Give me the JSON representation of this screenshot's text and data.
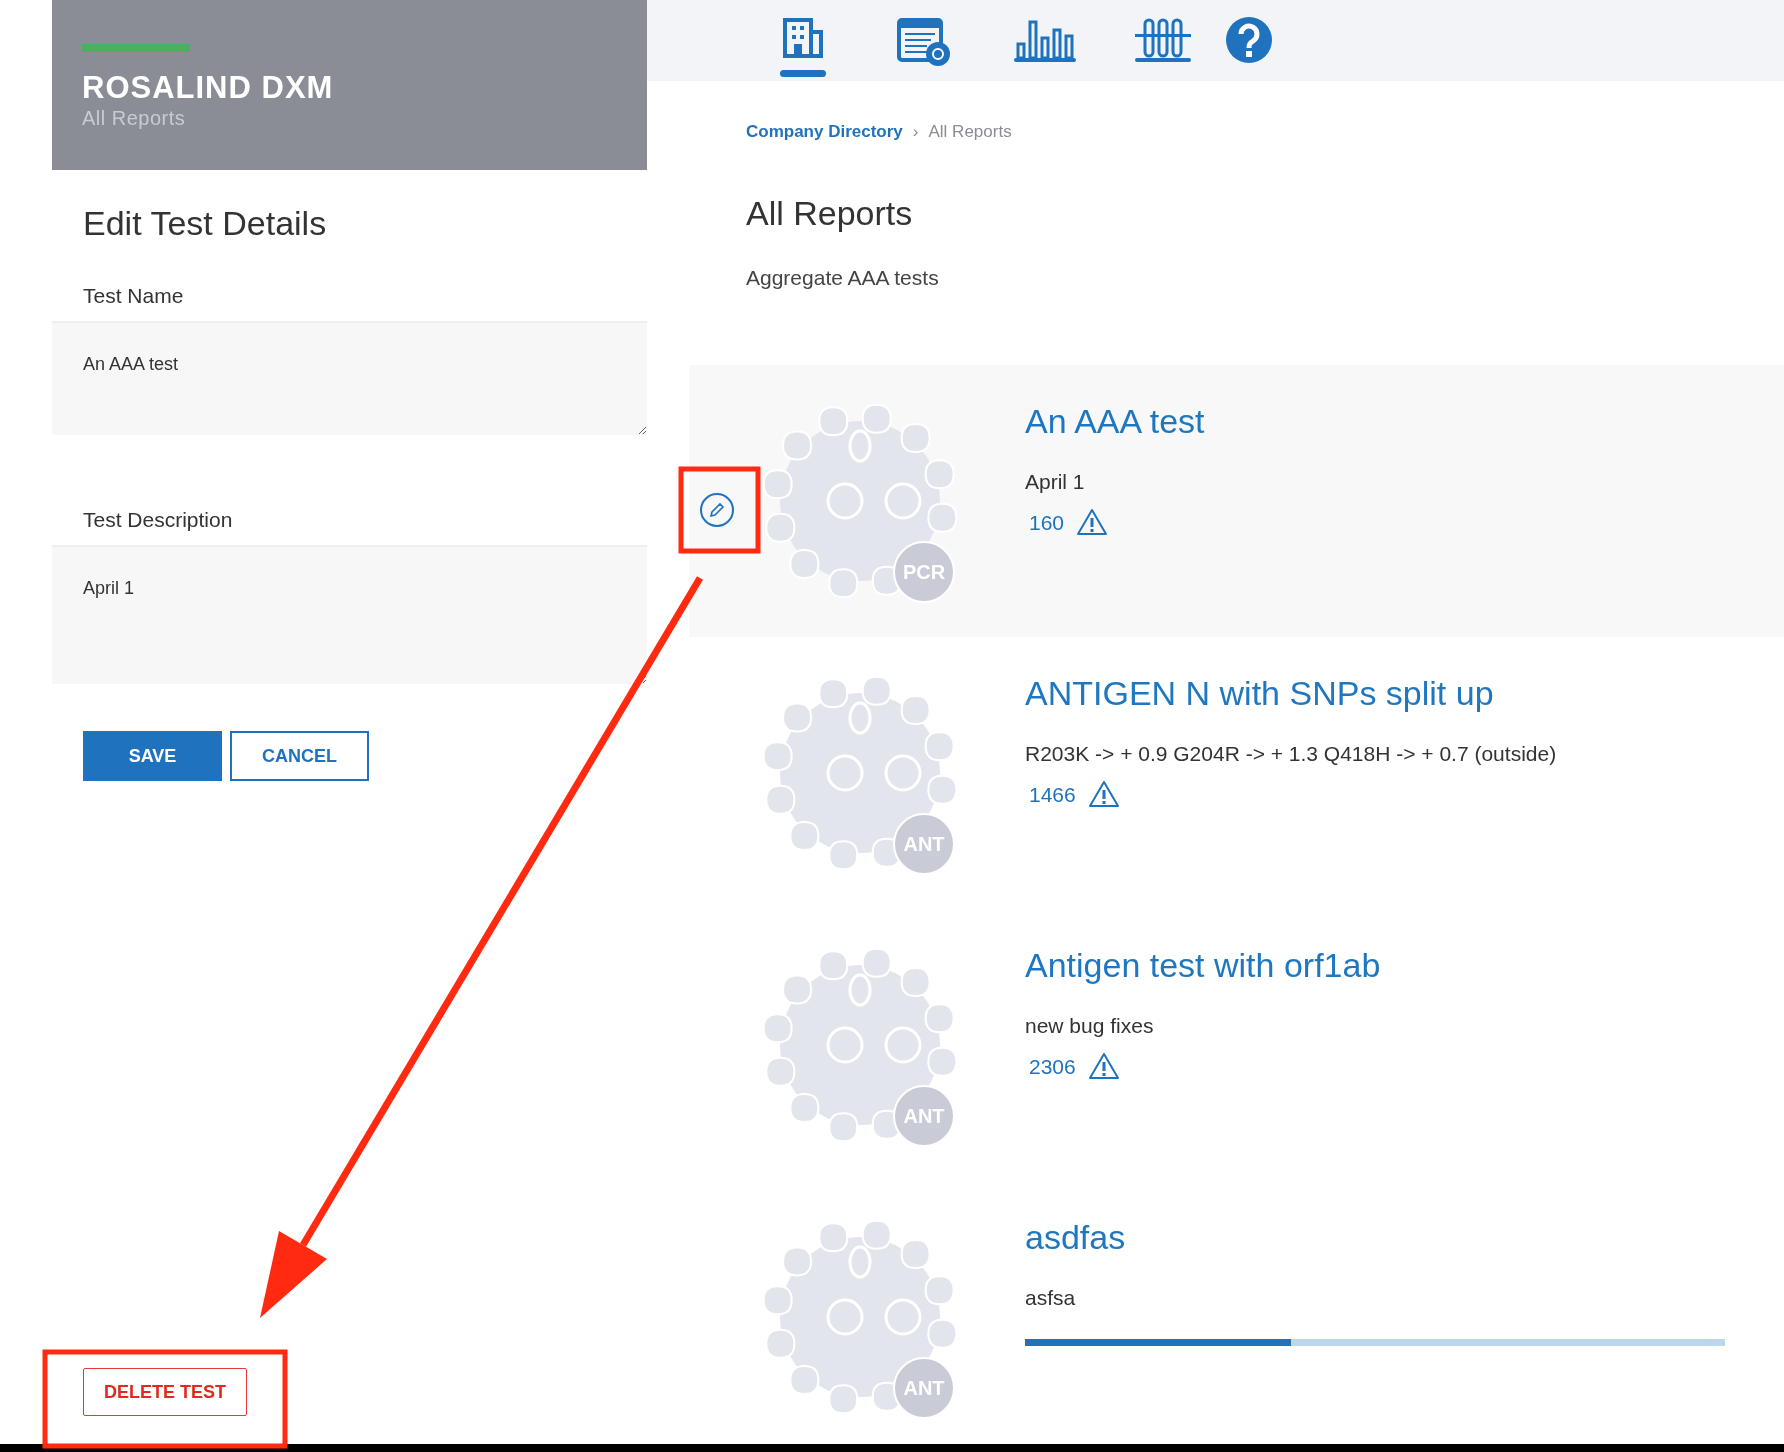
{
  "sidebar_header": {
    "title": "ROSALIND DXM",
    "subtitle": "All Reports"
  },
  "edit_panel": {
    "heading": "Edit Test Details",
    "fields": [
      {
        "label": "Test Name",
        "value": "An AAA test"
      },
      {
        "label": "Test Description",
        "value": "April 1"
      }
    ],
    "buttons": [
      {
        "label": "SAVE",
        "kind": "primary"
      },
      {
        "label": "CANCEL",
        "kind": "secondary"
      }
    ],
    "delete_button": "DELETE TEST"
  },
  "nav": {
    "tabs": [
      {
        "kind": "building",
        "selected": true
      },
      {
        "kind": "table",
        "selected": false
      },
      {
        "kind": "chart",
        "selected": false
      },
      {
        "kind": "tubes",
        "selected": false
      },
      {
        "kind": "help",
        "selected": false
      }
    ]
  },
  "breadcrumb": [
    {
      "label": "Company Directory",
      "current": false
    },
    {
      "label": "›",
      "kind": "separator"
    },
    {
      "label": "All Reports",
      "current": true
    }
  ],
  "page": {
    "title": "All Reports",
    "subtitle": "Aggregate AAA tests"
  },
  "reports": [
    {
      "title": "An AAA test",
      "description": "April 1",
      "badge": "PCR",
      "count": "160",
      "kind": "count",
      "highlighted": true
    },
    {
      "title": "ANTIGEN N with SNPs split up",
      "description": "R203K -> + 0.9 G204R -> + 1.3 Q418H -> + 0.7 (outside)",
      "badge": "ANT",
      "count": "1466",
      "kind": "count",
      "highlighted": false
    },
    {
      "title": "Antigen test with orf1ab",
      "description": "new bug fixes",
      "badge": "ANT",
      "count": "2306",
      "kind": "count",
      "highlighted": false
    },
    {
      "title": "asdfas",
      "description": "asfsa",
      "badge": "ANT",
      "kind": "progress",
      "level": 0.38,
      "highlighted": false
    }
  ]
}
